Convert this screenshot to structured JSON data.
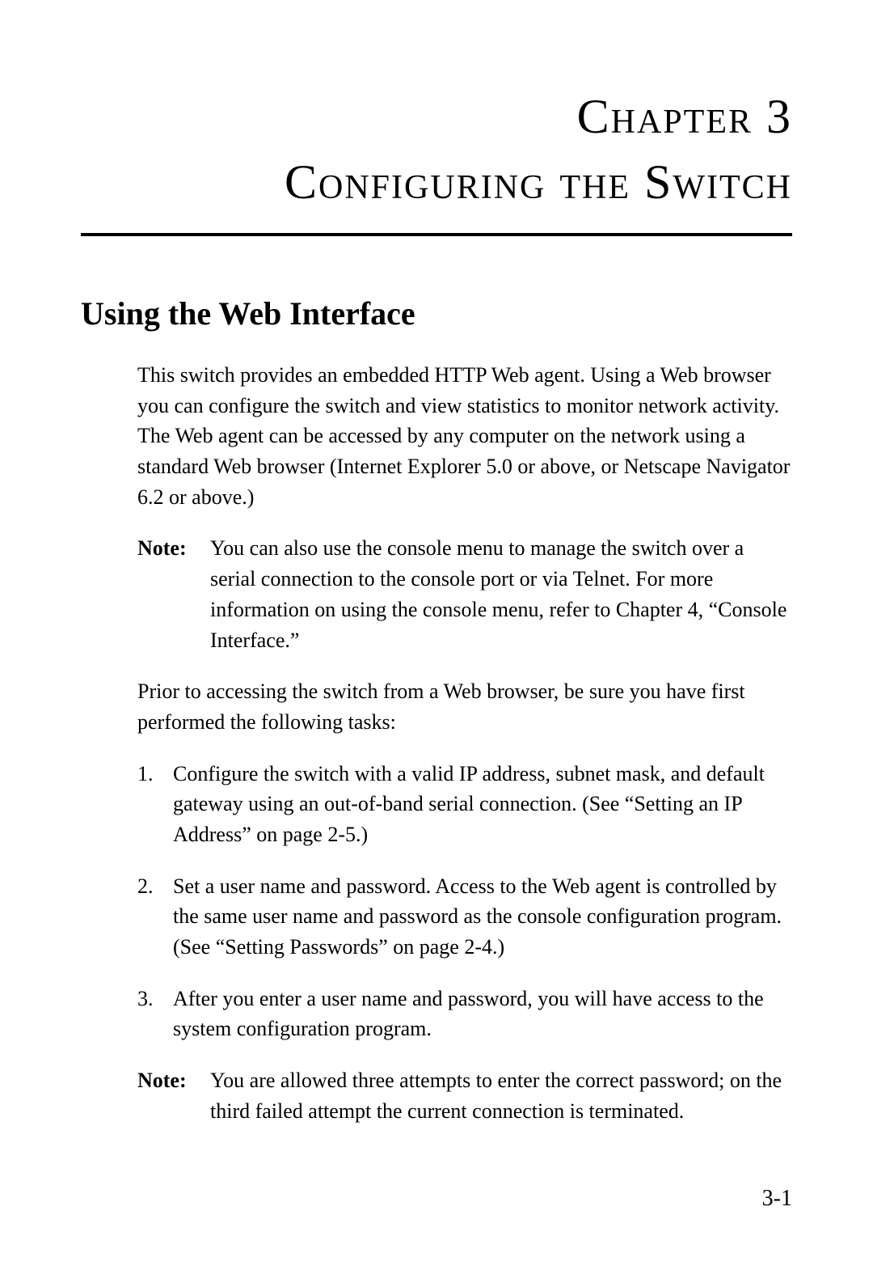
{
  "chapterNumber": "Chapter 3",
  "chapterTitle": "Configuring the Switch",
  "sectionHeading": "Using the Web Interface",
  "para1": "This switch provides an embedded HTTP Web agent. Using a Web browser you can configure the switch and view statistics to monitor network activity. The Web agent can be accessed by any computer on the network using a standard Web browser (Internet Explorer 5.0 or above, or Netscape Navigator 6.2 or above.)",
  "note1Label": "Note:",
  "note1Text": "You can also use the console menu to manage the switch over a serial connection to the console port or via Telnet. For more information on using the console menu, refer to Chapter 4, “Console Interface.”",
  "para2": "Prior to accessing the switch from a Web browser, be sure you have first performed the following tasks:",
  "list": {
    "item1Num": "1.",
    "item1Text": "Configure the switch with a valid IP address, subnet mask, and default gateway using an out-of-band serial connection. (See “Setting an IP Address” on page 2-5.)",
    "item2Num": "2.",
    "item2Text": "Set a user name and password. Access to the Web agent is controlled by the same user name and password as the console configuration program. (See “Setting Passwords” on page 2-4.)",
    "item3Num": "3.",
    "item3Text": "After you enter a user name and password, you will have access to the system configuration program."
  },
  "note2Label": "Note:",
  "note2Text": "You are allowed three attempts to enter the correct password; on the third failed attempt the current connection is terminated.",
  "pageNumber": "3-1"
}
